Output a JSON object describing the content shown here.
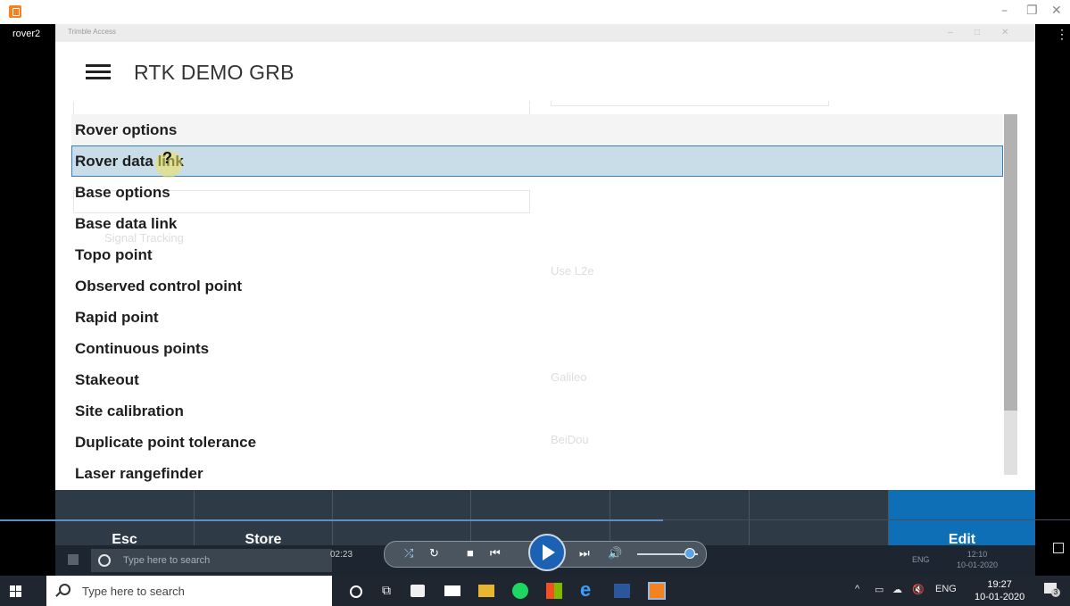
{
  "outer_window": {
    "minimize_glyph": "–",
    "restore_glyph": "❐",
    "close_glyph": "✕",
    "rover_label": "rover2",
    "more_glyph": "⋮"
  },
  "inner_window": {
    "title": "Trimble Access"
  },
  "app": {
    "title": "RTK DEMO GRB"
  },
  "menu": {
    "items": [
      "Rover options",
      "Rover data link",
      "Base options",
      "Base data link",
      "Topo point",
      "Observed control point",
      "Rapid point",
      "Continuous points",
      "Stakeout",
      "Site calibration",
      "Duplicate point tolerance",
      "Laser rangefinder"
    ],
    "selected_index": 1
  },
  "background_ghost_text": {
    "tracking": "Signal Tracking",
    "use_l2e": "Use L2e",
    "galileo": "Galileo",
    "beidou": "BeiDou"
  },
  "footer": {
    "esc_label": "Esc",
    "store_label": "Store",
    "edit_label": "Edit"
  },
  "ghost_taskbar": {
    "search_placeholder": "Type here to search",
    "time": "12:10",
    "date": "10-01-2020",
    "lang": "ENG"
  },
  "player": {
    "elapsed": "02:23",
    "seek_progress_percent": 62,
    "volume_percent": 85
  },
  "taskbar": {
    "search_placeholder": "Type here to search",
    "lang": "ENG",
    "time": "19:27",
    "date": "10-01-2020",
    "notification_count": "3"
  },
  "colors": {
    "selected_bg": "#c8dde8",
    "selected_border": "#3a7dc4",
    "footer_bg": "#2e3a46",
    "edit_bg": "#0f6fb6",
    "player_accent": "#1b62b5"
  }
}
